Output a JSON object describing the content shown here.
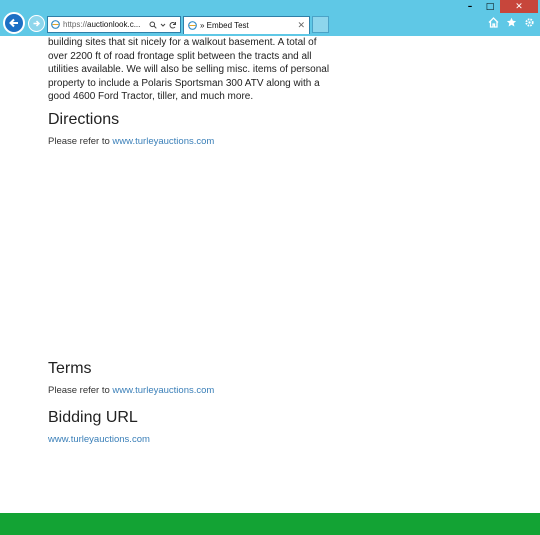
{
  "browser": {
    "address": {
      "scheme": "https://",
      "host": "auctionlook.c..."
    },
    "tab": {
      "title": "» Embed Test"
    },
    "window_controls": {
      "minimize": "–",
      "maximize": "□",
      "close": "✕"
    },
    "icons": [
      "back-arrow-icon",
      "forward-arrow-icon",
      "search-icon",
      "refresh-icon",
      "home-icon",
      "favorites-star-icon",
      "settings-gear-icon"
    ]
  },
  "page": {
    "intro_text": "building sites that sit nicely for a walkout basement. A total of over 2200 ft of road frontage split between the tracts and all utilities available. We will also be selling misc. items of personal property to include a Polaris Sportsman 300 ATV along with a good 4600 Ford Tractor, tiller, and much more.",
    "directions": {
      "heading": "Directions",
      "prefix": "Please refer to",
      "link": "www.turleyauctions.com"
    },
    "terms": {
      "heading": "Terms",
      "prefix": "Please refer to",
      "link": "www.turleyauctions.com"
    },
    "bidding": {
      "heading": "Bidding URL",
      "link": "www.turleyauctions.com"
    },
    "footer_color": "#13a334"
  }
}
